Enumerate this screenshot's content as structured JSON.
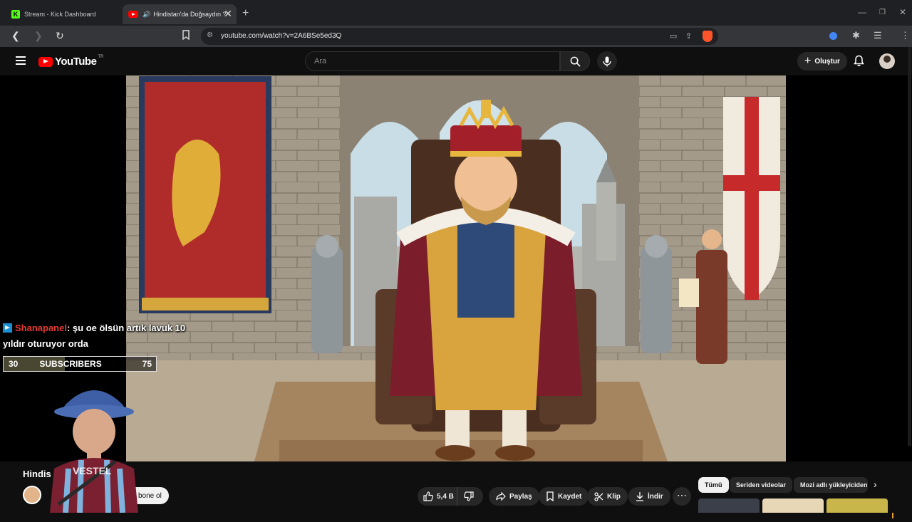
{
  "browser": {
    "tabs": [
      {
        "title": "Stream - Kick Dashboard"
      },
      {
        "title": "Hindistan'da Doğsaydın ? -"
      }
    ],
    "new_tab": "+",
    "url": "youtube.com/watch?v=2A6BSe5ed3Q"
  },
  "youtube": {
    "logo_text": "YouTube",
    "country_code": "TR",
    "search_placeholder": "Ara",
    "create_label": "Oluştur"
  },
  "overlay": {
    "chat_user": "Shanapanel",
    "chat_message": ": şu oe ölsün artık lavuk 10 yıldır oturuyor orda",
    "sub_current": "30",
    "sub_label": "SUBSCRIBERS",
    "sub_goal": "75",
    "sub_progress_fraction": 0.4
  },
  "video": {
    "title_partial": "Hindis",
    "subscribe_label": "bone ol",
    "actions": {
      "likes": "5,4 B",
      "share": "Paylaş",
      "save": "Kaydet",
      "clip": "Klip",
      "download": "İndir",
      "more": "⋯"
    }
  },
  "recommend_chips": [
    "Tümü",
    "Seriden videolar",
    "Mozi adlı yükleyiciden"
  ],
  "colors": {
    "accent_red": "#ff0000",
    "kick_green": "#53fc18",
    "chat_user": "#e53a35"
  }
}
